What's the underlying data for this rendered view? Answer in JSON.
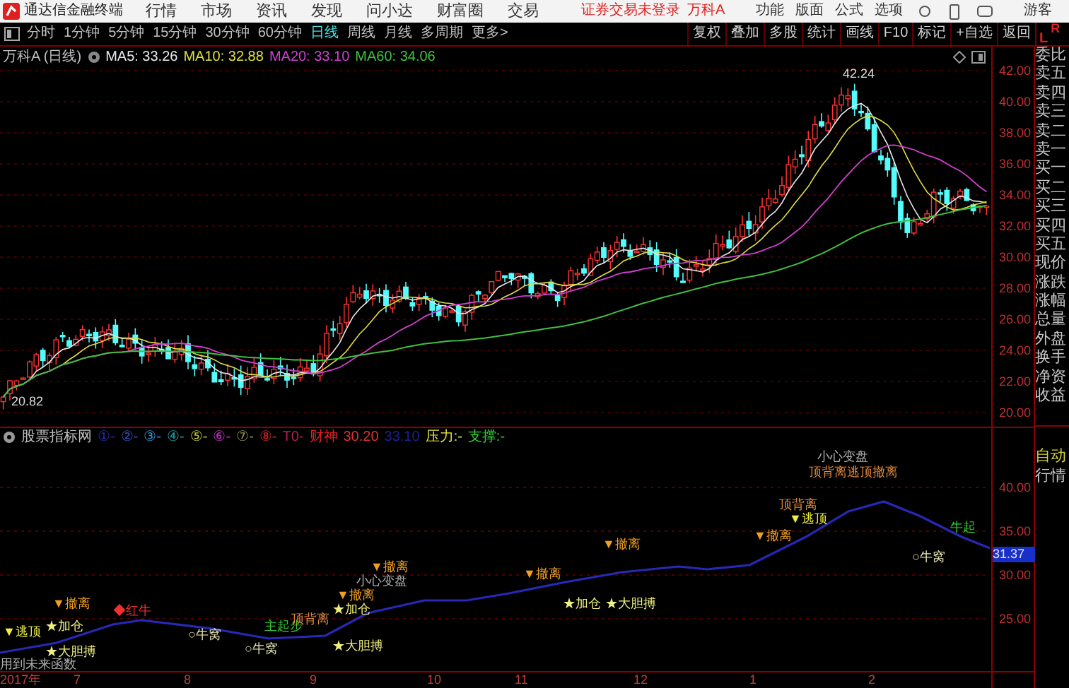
{
  "app": {
    "title": "通达信金融终端",
    "menu": [
      "行情",
      "市场",
      "资讯",
      "发现",
      "问小达",
      "财富圈",
      "交易"
    ],
    "notice": "证券交易未登录",
    "stock": "万科A",
    "right_menu": [
      "功能",
      "版面",
      "公式",
      "选项"
    ],
    "user": "游客"
  },
  "periods": [
    {
      "label": "分时",
      "selected": false
    },
    {
      "label": "1分钟",
      "selected": false
    },
    {
      "label": "5分钟",
      "selected": false
    },
    {
      "label": "15分钟",
      "selected": false
    },
    {
      "label": "30分钟",
      "selected": false
    },
    {
      "label": "60分钟",
      "selected": false
    },
    {
      "label": "日线",
      "selected": true
    },
    {
      "label": "周线",
      "selected": false
    },
    {
      "label": "月线",
      "selected": false
    },
    {
      "label": "多周期",
      "selected": false
    },
    {
      "label": "更多>",
      "selected": false
    }
  ],
  "tools": [
    "复权",
    "叠加",
    "多股",
    "统计",
    "画线",
    "F10",
    "标记",
    "+自选",
    "返回"
  ],
  "corner": {
    "left": "L",
    "right": "R"
  },
  "info": {
    "title": "万科A (日线)",
    "ma": [
      {
        "text": "MA5: 33.26",
        "color": "#e8e8e8"
      },
      {
        "text": "MA10: 32.88",
        "color": "#e0e040"
      },
      {
        "text": "MA20: 33.10",
        "color": "#d040d0"
      },
      {
        "text": "MA60: 34.06",
        "color": "#40c040"
      }
    ]
  },
  "price_chart": {
    "high_label": "42.24",
    "low_label": "20.82",
    "axis": [
      "42.00",
      "40.00",
      "38.00",
      "36.00",
      "34.00",
      "32.00",
      "30.00",
      "28.00",
      "26.00",
      "24.00",
      "22.00",
      "20.00"
    ]
  },
  "indicator": {
    "name": "股票指标网",
    "items": [
      {
        "text": "①-",
        "color": "#2a2ab0"
      },
      {
        "text": "②-",
        "color": "#3050c0"
      },
      {
        "text": "③-",
        "color": "#3090d0"
      },
      {
        "text": "④-",
        "color": "#20a0a0"
      },
      {
        "text": "⑤-",
        "color": "#c0c040"
      },
      {
        "text": "⑥-",
        "color": "#c030c0"
      },
      {
        "text": "⑦-",
        "color": "#909050"
      },
      {
        "text": "⑧-",
        "color": "#d02020"
      },
      {
        "text": "T0-",
        "color": "#b02050"
      },
      {
        "text": "财神",
        "color": "#e02020"
      },
      {
        "text": "30.20",
        "color": "#e03030"
      },
      {
        "text": "33.10",
        "color": "#202090"
      },
      {
        "text": "压力:-",
        "color": "#e0e040"
      },
      {
        "text": "支撑:-",
        "color": "#30d030"
      }
    ],
    "axis": [
      "40.00",
      "35.00",
      "30.00",
      "25.00"
    ],
    "current": "31.37",
    "signals": [
      {
        "text": "▼逃顶",
        "kind": "escape"
      },
      {
        "text": "▼撤离",
        "kind": "sell"
      },
      {
        "text": "★加仓",
        "kind": "buy"
      },
      {
        "text": "★大胆搏",
        "kind": "buy"
      },
      {
        "text": "◆红牛",
        "kind": "bull"
      },
      {
        "text": "○牛窝",
        "kind": "nest"
      },
      {
        "text": "○牛窝",
        "kind": "nest"
      },
      {
        "text": "主起步",
        "kind": "start"
      },
      {
        "text": "顶背离",
        "kind": "divergence"
      },
      {
        "text": "▼撤离",
        "kind": "sell"
      },
      {
        "text": "★加仓",
        "kind": "buy"
      },
      {
        "text": "★大胆搏",
        "kind": "buy"
      },
      {
        "text": "▼撤离",
        "kind": "sell"
      },
      {
        "text": "小心变盘",
        "kind": "note"
      },
      {
        "text": "▼撤离",
        "kind": "sell"
      },
      {
        "text": "▼撤离",
        "kind": "sell"
      },
      {
        "text": "★加仓",
        "kind": "buy"
      },
      {
        "text": "★大胆搏",
        "kind": "buy"
      },
      {
        "text": "▼撤离",
        "kind": "sell"
      },
      {
        "text": "顶背离",
        "kind": "divergence"
      },
      {
        "text": "▼逃顶",
        "kind": "escape"
      },
      {
        "text": "小心变盘",
        "kind": "note"
      },
      {
        "text": "顶背离逃顶撤离",
        "kind": "divergence"
      },
      {
        "text": "○牛窝",
        "kind": "nest"
      },
      {
        "text": "牛起",
        "kind": "start"
      },
      {
        "text": "用到未来函数",
        "kind": "note"
      }
    ]
  },
  "dates": [
    "2017年",
    "7",
    "8",
    "9",
    "10",
    "11",
    "12",
    "1",
    "2"
  ],
  "quote_panel": {
    "labels": [
      "委比",
      "卖五",
      "卖四",
      "卖三",
      "卖二",
      "卖一",
      "买一",
      "买二",
      "买三",
      "买四",
      "买五",
      "现价",
      "涨跌",
      "涨幅",
      "总量",
      "外盘",
      "换手",
      "净资",
      "收益"
    ],
    "auto": "自动",
    "market": "行情"
  }
}
